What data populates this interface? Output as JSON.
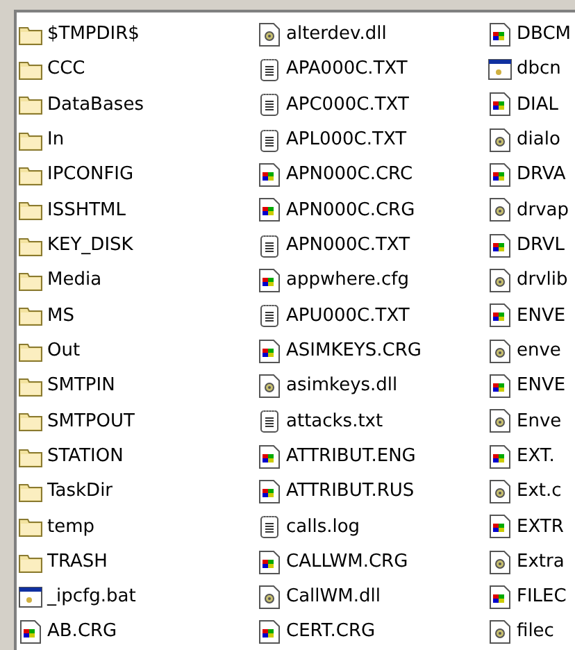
{
  "columns": [
    {
      "items": [
        {
          "name": "$TMPDIR$",
          "kind": "folder"
        },
        {
          "name": "CCC",
          "kind": "folder"
        },
        {
          "name": "DataBases",
          "kind": "folder"
        },
        {
          "name": "In",
          "kind": "folder"
        },
        {
          "name": "IPCONFIG",
          "kind": "folder"
        },
        {
          "name": "ISSHTML",
          "kind": "folder"
        },
        {
          "name": "KEY_DISK",
          "kind": "folder"
        },
        {
          "name": "Media",
          "kind": "folder"
        },
        {
          "name": "MS",
          "kind": "folder"
        },
        {
          "name": "Out",
          "kind": "folder"
        },
        {
          "name": "SMTPIN",
          "kind": "folder"
        },
        {
          "name": "SMTPOUT",
          "kind": "folder"
        },
        {
          "name": "STATION",
          "kind": "folder"
        },
        {
          "name": "TaskDir",
          "kind": "folder"
        },
        {
          "name": "temp",
          "kind": "folder"
        },
        {
          "name": "TRASH",
          "kind": "folder"
        },
        {
          "name": "_ipcfg.bat",
          "kind": "batch"
        },
        {
          "name": "AB.CRG",
          "kind": "app"
        }
      ]
    },
    {
      "items": [
        {
          "name": "alterdev.dll",
          "kind": "library"
        },
        {
          "name": "APA000C.TXT",
          "kind": "text"
        },
        {
          "name": "APC000C.TXT",
          "kind": "text"
        },
        {
          "name": "APL000C.TXT",
          "kind": "text"
        },
        {
          "name": "APN000C.CRC",
          "kind": "app"
        },
        {
          "name": "APN000C.CRG",
          "kind": "app"
        },
        {
          "name": "APN000C.TXT",
          "kind": "text"
        },
        {
          "name": "appwhere.cfg",
          "kind": "app"
        },
        {
          "name": "APU000C.TXT",
          "kind": "text"
        },
        {
          "name": "ASIMKEYS.CRG",
          "kind": "app"
        },
        {
          "name": "asimkeys.dll",
          "kind": "library"
        },
        {
          "name": "attacks.txt",
          "kind": "text"
        },
        {
          "name": "ATTRIBUT.ENG",
          "kind": "app"
        },
        {
          "name": "ATTRIBUT.RUS",
          "kind": "app"
        },
        {
          "name": "calls.log",
          "kind": "text"
        },
        {
          "name": "CALLWM.CRG",
          "kind": "app"
        },
        {
          "name": "CallWM.dll",
          "kind": "library"
        },
        {
          "name": "CERT.CRG",
          "kind": "app"
        }
      ]
    },
    {
      "items": [
        {
          "name": "DBCM",
          "kind": "app"
        },
        {
          "name": "dbcn",
          "kind": "batch"
        },
        {
          "name": "DIAL",
          "kind": "app"
        },
        {
          "name": "dialo",
          "kind": "library"
        },
        {
          "name": "DRVA",
          "kind": "app"
        },
        {
          "name": "drvap",
          "kind": "library"
        },
        {
          "name": "DRVL",
          "kind": "app"
        },
        {
          "name": "drvlib",
          "kind": "library"
        },
        {
          "name": "ENVE",
          "kind": "app"
        },
        {
          "name": "enve",
          "kind": "library"
        },
        {
          "name": "ENVE",
          "kind": "app"
        },
        {
          "name": "Enve",
          "kind": "library"
        },
        {
          "name": "EXT.",
          "kind": "app"
        },
        {
          "name": "Ext.c",
          "kind": "library"
        },
        {
          "name": "EXTR",
          "kind": "app"
        },
        {
          "name": "Extra",
          "kind": "library"
        },
        {
          "name": "FILEC",
          "kind": "app"
        },
        {
          "name": "filec",
          "kind": "library"
        }
      ]
    }
  ]
}
